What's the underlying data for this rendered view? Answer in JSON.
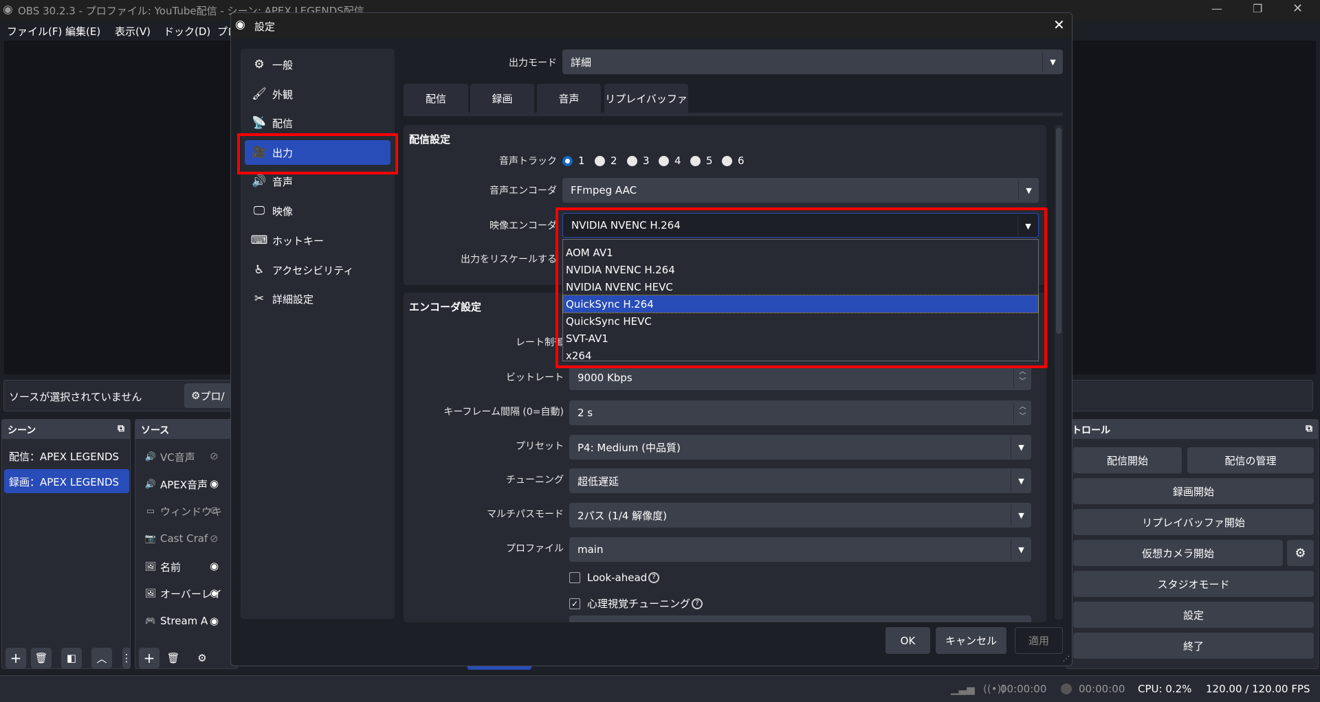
{
  "window": {
    "title": "OBS 30.2.3 - プロファイル: YouTube配信 - シーン: APEX LEGENDS配信"
  },
  "menu": [
    "ファイル(F)",
    "編集(E)",
    "表示(V)",
    "ドック(D)",
    "プロ"
  ],
  "source_bar": {
    "no_source": "ソースが選択されていません",
    "properties": "プロ/"
  },
  "scenes": {
    "title": "シーン",
    "items": [
      "配信：APEX LEGENDS",
      "録画：APEX LEGENDS"
    ],
    "selected": 1
  },
  "sources": {
    "title": "ソース",
    "items": [
      {
        "name": "VC音声",
        "icon": "speaker-icon",
        "visible": false
      },
      {
        "name": "APEX音声",
        "icon": "speaker-icon",
        "visible": true
      },
      {
        "name": "ウィンドウキ",
        "icon": "window-icon",
        "visible": false
      },
      {
        "name": "Cast Craf",
        "icon": "camera-icon",
        "visible": false
      },
      {
        "name": "名前",
        "icon": "image-icon",
        "visible": true
      },
      {
        "name": "オーバーレイ",
        "icon": "image-icon",
        "visible": true
      },
      {
        "name": "Stream A",
        "icon": "gamepad-icon",
        "visible": true
      }
    ]
  },
  "controls": {
    "title": "トロール",
    "start_stream": "配信開始",
    "manage_stream": "配信の管理",
    "start_record": "録画開始",
    "start_replay": "リプレイバッファ開始",
    "start_vcam": "仮想カメラ開始",
    "studio_mode": "スタジオモード",
    "settings": "設定",
    "exit": "終了"
  },
  "status": {
    "stream_time": "00:00:00",
    "record_time": "00:00:00",
    "cpu": "CPU: 0.2%",
    "fps": "120.00 / 120.00 FPS"
  },
  "dialog": {
    "title": "設定",
    "sidebar": [
      {
        "label": "一般",
        "icon": "gear-icon"
      },
      {
        "label": "外観",
        "icon": "appearance-icon"
      },
      {
        "label": "配信",
        "icon": "antenna-icon"
      },
      {
        "label": "出力",
        "icon": "output-icon"
      },
      {
        "label": "音声",
        "icon": "speaker-icon"
      },
      {
        "label": "映像",
        "icon": "monitor-icon"
      },
      {
        "label": "ホットキー",
        "icon": "keyboard-icon"
      },
      {
        "label": "アクセシビリティ",
        "icon": "accessibility-icon"
      },
      {
        "label": "詳細設定",
        "icon": "tools-icon"
      }
    ],
    "sidebar_selected": 3,
    "output_mode": {
      "label": "出力モード",
      "value": "詳細"
    },
    "tabs": [
      "配信",
      "録画",
      "音声",
      "リプレイバッファ"
    ],
    "active_tab": 0,
    "stream_group": {
      "title": "配信設定",
      "audio_track_label": "音声トラック",
      "audio_tracks": [
        "1",
        "2",
        "3",
        "4",
        "5",
        "6"
      ],
      "audio_track_selected": "1",
      "audio_encoder_label": "音声エンコーダ",
      "audio_encoder": "FFmpeg AAC",
      "video_encoder_label": "映像エンコーダ",
      "video_encoder": "NVIDIA NVENC H.264",
      "rescale_label": "出力をリスケールする",
      "encoder_options": [
        "AOM AV1",
        "NVIDIA NVENC H.264",
        "NVIDIA NVENC HEVC",
        "QuickSync H.264",
        "QuickSync HEVC",
        "SVT-AV1",
        "x264"
      ],
      "encoder_highlighted": 3
    },
    "encoder_group": {
      "title": "エンコーダ設定",
      "rate_control_label": "レート制御",
      "bitrate_label": "ビットレート",
      "bitrate": "9000 Kbps",
      "keyframe_label": "キーフレーム間隔 (0=自動)",
      "keyframe": "2 s",
      "preset_label": "プリセット",
      "preset": "P4: Medium (中品質)",
      "tuning_label": "チューニング",
      "tuning": "超低遅延",
      "multipass_label": "マルチパスモード",
      "multipass": "2パス (1/4 解像度)",
      "profile_label": "プロファイル",
      "profile": "main",
      "lookahead_label": "Look-ahead",
      "lookahead": false,
      "psycho_label": "心理視覚チューニング",
      "psycho": true
    },
    "buttons": {
      "ok": "OK",
      "cancel": "キャンセル",
      "apply": "適用"
    }
  },
  "colors": {
    "accent": "#284cb8",
    "highlight_box": "#ff0000"
  }
}
